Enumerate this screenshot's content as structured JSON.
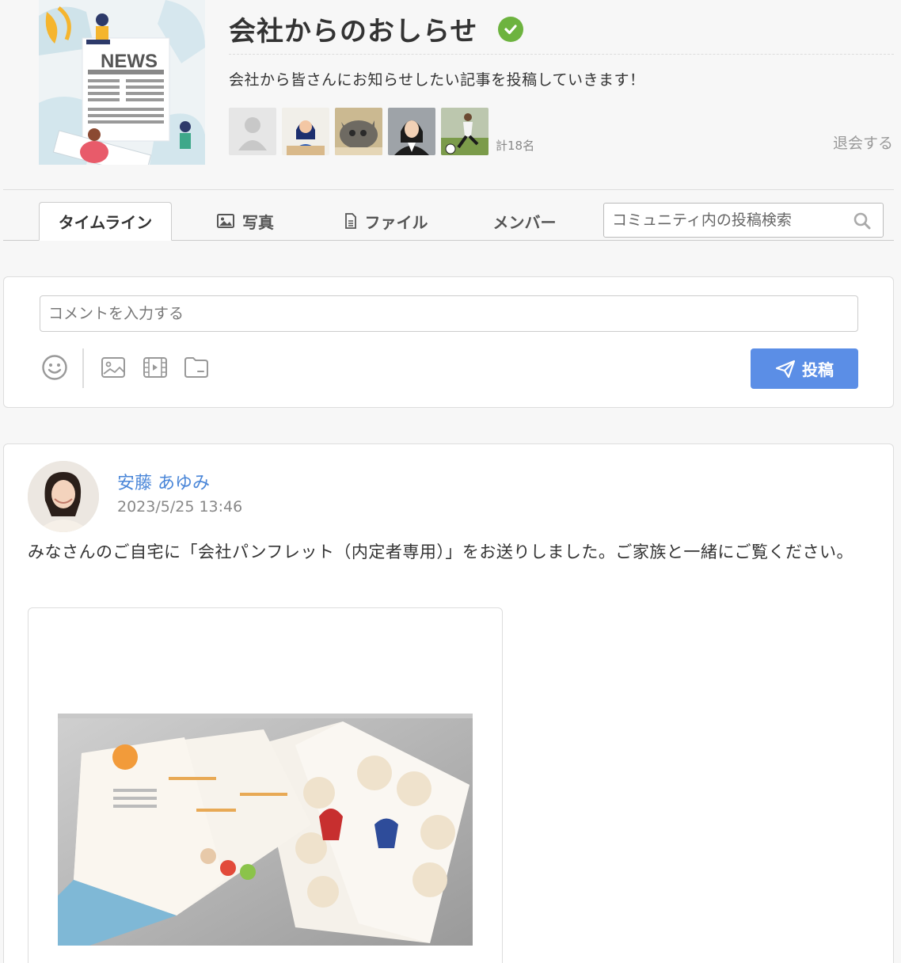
{
  "community": {
    "cover_image": "news-illustration",
    "cover_text": "NEWS",
    "title": "会社からのおしらせ",
    "verified_icon": "check-circle-icon",
    "description": "会社から皆さんにお知らせしたい記事を投稿していきます！",
    "member_avatars": [
      "default-avatar",
      "woman-at-laptop",
      "cat-photo",
      "woman-portrait",
      "soccer-player"
    ],
    "member_count": "計18名",
    "leave_label": "退会する"
  },
  "tabs": [
    {
      "label": "タイムライン",
      "icon": ""
    },
    {
      "label": "写真",
      "icon": "image-icon"
    },
    {
      "label": "ファイル",
      "icon": "file-icon"
    },
    {
      "label": "メンバー",
      "icon": ""
    }
  ],
  "search": {
    "placeholder": "コミュニティ内の投稿検索",
    "icon": "search-icon"
  },
  "composer": {
    "placeholder": "コメントを入力する",
    "tools": [
      "emoji-icon",
      "image-icon",
      "video-icon",
      "folder-icon"
    ],
    "post_label": "投稿",
    "post_icon": "send-icon"
  },
  "post": {
    "author": "安藤 あゆみ",
    "timestamp": "2023/5/25 13:46",
    "text": "みなさんのご自宅に「会社パンフレット（内定者専用）」をお送りしました。ご家族と一緒にご覧ください。",
    "attachment_image": "company-pamphlet-photo"
  },
  "colors": {
    "accent": "#5b8ee6",
    "author_link": "#4a86d8",
    "verified": "#6db33f"
  }
}
